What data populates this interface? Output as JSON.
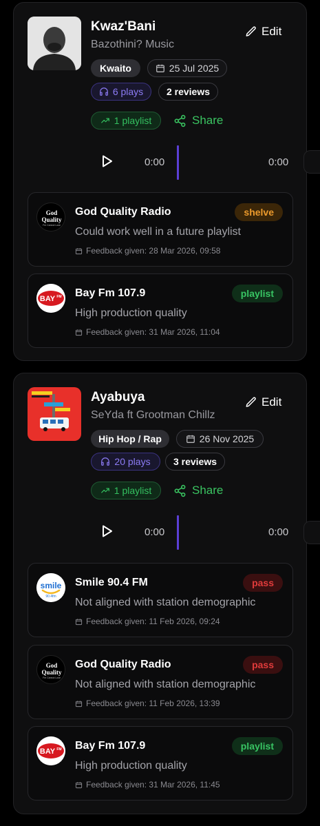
{
  "colors": {
    "accent_purple": "#5b3fd6",
    "green": "#38c463",
    "orange": "#ec9a2c",
    "red": "#e03b3b"
  },
  "tracks": [
    {
      "title": "Kwaz'Bani",
      "artist": "Bazothini? Music",
      "edit_label": "Edit",
      "genre": "Kwaito",
      "date": "25 Jul 2025",
      "plays": "6 plays",
      "reviews": "2 reviews",
      "playlist_count": "1 playlist",
      "share_label": "Share",
      "current_time": "0:00",
      "duration": "0:00",
      "feedback": [
        {
          "station": "God Quality Radio",
          "logo": "god-quality-radio-logo",
          "logo_text": [
            "God",
            "Quality",
            "Fm Cannot Lose"
          ],
          "status": "shelve",
          "comment": "Could work well in a future playlist",
          "date_label": "Feedback given: 28 Mar 2026, 09:58"
        },
        {
          "station": "Bay Fm 107.9",
          "logo": "bay-fm-logo",
          "logo_text": [
            "BAY",
            "FM"
          ],
          "status": "playlist",
          "comment": "High production quality",
          "date_label": "Feedback given: 31 Mar 2026, 11:04"
        }
      ]
    },
    {
      "title": "Ayabuya",
      "artist": "SeYda ft Grootman Chillz",
      "edit_label": "Edit",
      "genre": "Hip Hop / Rap",
      "date": "26 Nov 2025",
      "plays": "20 plays",
      "reviews": "3 reviews",
      "playlist_count": "1 playlist",
      "share_label": "Share",
      "current_time": "0:00",
      "duration": "0:00",
      "feedback": [
        {
          "station": "Smile 90.4 FM",
          "logo": "smile-fm-logo",
          "logo_text": [
            "smile",
            "90.4fm"
          ],
          "status": "pass",
          "comment": "Not aligned with station demographic",
          "date_label": "Feedback given: 11 Feb 2026, 09:24"
        },
        {
          "station": "God Quality Radio",
          "logo": "god-quality-radio-logo",
          "logo_text": [
            "God",
            "Quality",
            "Fm Cannot Lose"
          ],
          "status": "pass",
          "comment": "Not aligned with station demographic",
          "date_label": "Feedback given: 11 Feb 2026, 13:39"
        },
        {
          "station": "Bay Fm 107.9",
          "logo": "bay-fm-logo",
          "logo_text": [
            "BAY",
            "FM"
          ],
          "status": "playlist",
          "comment": "High production quality",
          "date_label": "Feedback given: 31 Mar 2026, 11:45"
        }
      ]
    }
  ]
}
